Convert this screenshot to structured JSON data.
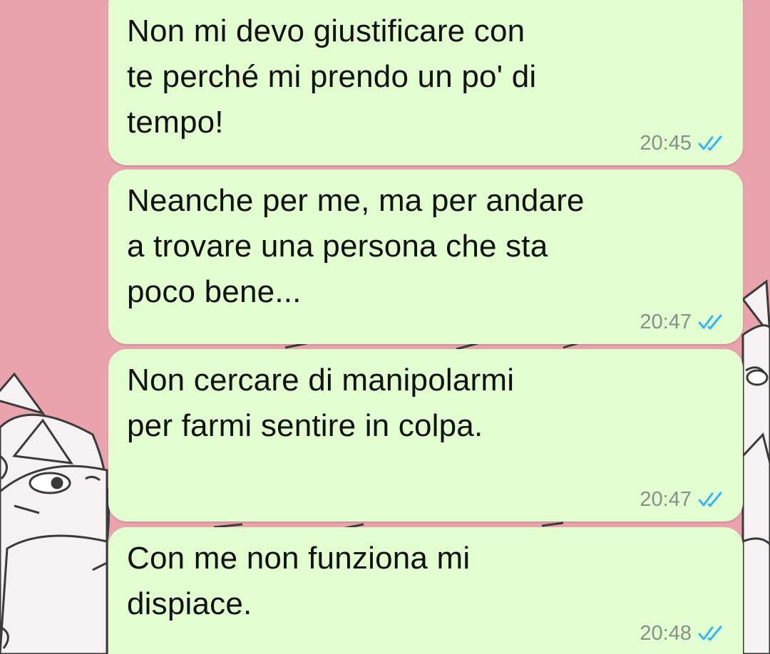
{
  "messages": [
    {
      "text": "Non mi devo giustificare con\nte perché mi prendo un po' di\ntempo!",
      "time": "20:45",
      "status": "read"
    },
    {
      "text": "Neanche per me, ma per andare\na trovare una persona che sta\npoco bene...",
      "time": "20:47",
      "status": "read"
    },
    {
      "text": "Non cercare di manipolarmi\nper farmi sentire in colpa.",
      "time": "20:47",
      "status": "read"
    },
    {
      "text": "Con me non funziona mi\ndispiace.",
      "time": "20:48",
      "status": "read"
    }
  ],
  "colors": {
    "wallpaper": "#e9a3ad",
    "bubble": "#e2fdd0",
    "read_ticks": "#34b7f1",
    "time_text": "#8a8f8a"
  },
  "icons": {
    "read_receipt": "double-check-icon",
    "wallpaper_art": "cat-doodle-wallpaper"
  }
}
